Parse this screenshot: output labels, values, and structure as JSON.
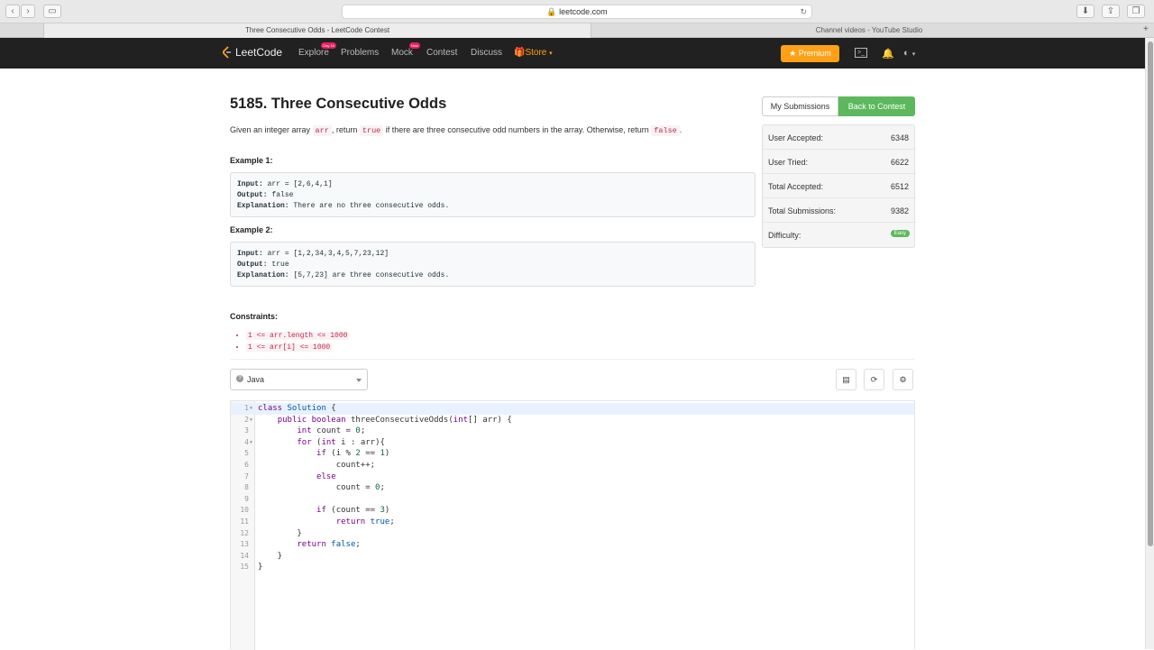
{
  "browser": {
    "url": "leetcode.com",
    "tabs": [
      {
        "label": "Three Consecutive Odds - LeetCode Contest",
        "active": true
      },
      {
        "label": "Channel videos - YouTube Studio",
        "active": false
      }
    ]
  },
  "nav": {
    "logo": "LeetCode",
    "items": [
      {
        "label": "Explore",
        "badge": "Day 16"
      },
      {
        "label": "Problems",
        "badge": ""
      },
      {
        "label": "Mock",
        "badge": "New"
      },
      {
        "label": "Contest",
        "badge": ""
      },
      {
        "label": "Discuss",
        "badge": ""
      },
      {
        "label": "Store",
        "badge": ""
      }
    ],
    "premium": "Premium"
  },
  "problem": {
    "title": "5185. Three Consecutive Odds",
    "desc_parts": [
      "Given an integer array ",
      "arr",
      ", return ",
      "true",
      " if there are three consecutive odd numbers in the array. Otherwise, return ",
      "false",
      "."
    ],
    "example1": {
      "label": "Example 1:",
      "input_label": "Input:",
      "input": "arr = [2,6,4,1]",
      "output_label": "Output:",
      "output": "false",
      "explanation_label": "Explanation:",
      "explanation": "There are no three consecutive odds."
    },
    "example2": {
      "label": "Example 2:",
      "input_label": "Input:",
      "input": "arr = [1,2,34,3,4,5,7,23,12]",
      "output_label": "Output:",
      "output": "true",
      "explanation_label": "Explanation:",
      "explanation": "[5,7,23] are three consecutive odds."
    },
    "constraints_label": "Constraints:",
    "constraints": [
      "1 <= arr.length <= 1000",
      "1 <= arr[i] <= 1000"
    ]
  },
  "panel": {
    "my_submissions": "My Submissions",
    "back_to_contest": "Back to Contest",
    "stats": [
      {
        "label": "User Accepted:",
        "value": "6348"
      },
      {
        "label": "User Tried:",
        "value": "6622"
      },
      {
        "label": "Total Accepted:",
        "value": "6512"
      },
      {
        "label": "Total Submissions:",
        "value": "9382"
      },
      {
        "label": "Difficulty:",
        "value": "Easy"
      }
    ],
    "easy_color": "#5cb85c"
  },
  "editor": {
    "language": "Java",
    "lines": [
      "class Solution {",
      "    public boolean threeConsecutiveOdds(int[] arr) {",
      "        int count = 0;",
      "        for (int i : arr){",
      "            if (i % 2 == 1)",
      "                count++;",
      "            else",
      "                count = 0;",
      "",
      "            if (count == 3)",
      "                return true;",
      "        }",
      "        return false;",
      "    }",
      "}"
    ],
    "line_numbers": [
      "1",
      "2",
      "3",
      "4",
      "5",
      "6",
      "7",
      "8",
      "9",
      "10",
      "11",
      "12",
      "13",
      "14",
      "15"
    ],
    "fold_lines": [
      1,
      2,
      4
    ]
  }
}
